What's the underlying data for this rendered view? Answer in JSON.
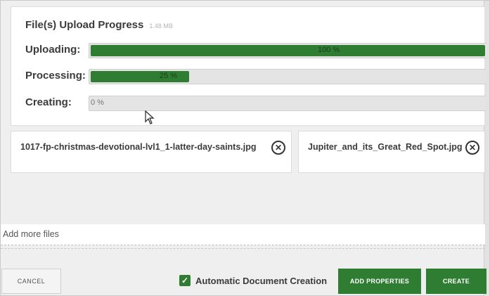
{
  "upload": {
    "title": "File(s) Upload Progress",
    "size": "1.48 MB",
    "rows": [
      {
        "label": "Uploading:",
        "progress": 1.0,
        "text": "100 %"
      },
      {
        "label": "Processing:",
        "progress": 0.25,
        "text": "25 %"
      },
      {
        "label": "Creating:",
        "progress": 0.0,
        "text": "0 %"
      }
    ]
  },
  "files": [
    {
      "name": "1017-fp-christmas-devotional-lvl1_1-latter-day-saints.jpg",
      "icon": "close-circle-icon"
    },
    {
      "name": "Jupiter_and_its_Great_Red_Spot.jpg",
      "icon": "close-circle-icon"
    }
  ],
  "add_more": {
    "label": "Add more files"
  },
  "footer": {
    "cancel_label": "CANCEL",
    "auto_create_label": "Automatic Document Creation",
    "auto_create_checked": true,
    "add_properties_label": "ADD PROPERTIES",
    "create_label": "CREATE"
  },
  "colors": {
    "accent": "#2e7d32",
    "bar_track": "#e4e4e4",
    "background": "#efefef"
  }
}
